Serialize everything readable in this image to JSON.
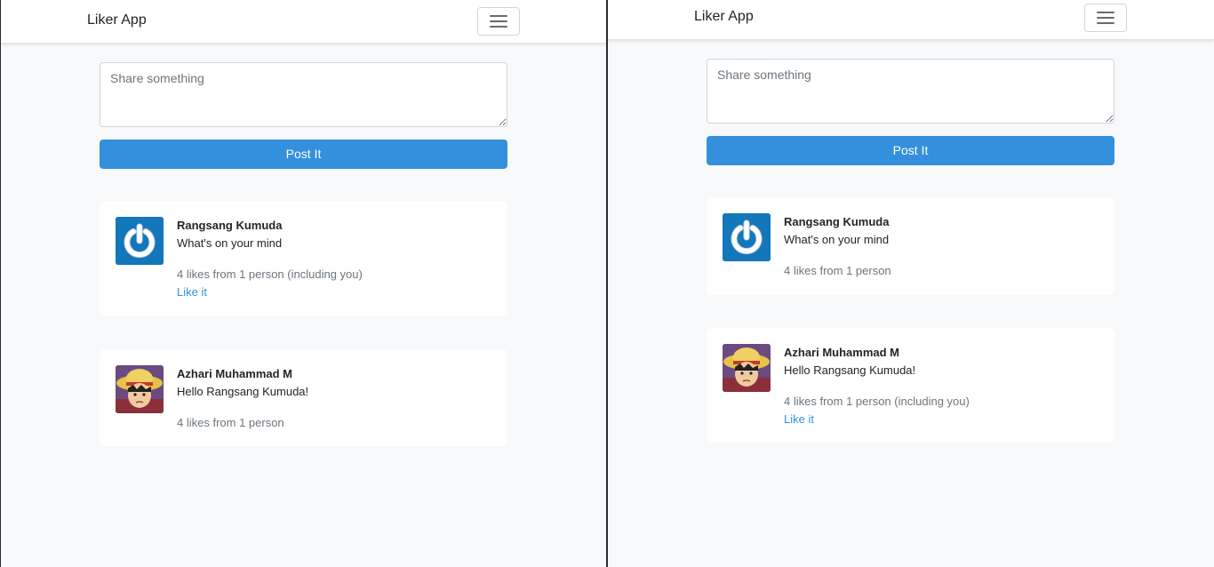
{
  "colors": {
    "primary": "#3490dc",
    "background": "#f8f9fa",
    "card": "#ffffff",
    "muted": "#6c757d"
  },
  "panes": [
    {
      "navbar": {
        "brand": "Liker App",
        "toggler_icon": "hamburger-icon"
      },
      "composer": {
        "placeholder": "Share something",
        "button": "Post It"
      },
      "posts": [
        {
          "avatar": "power-icon-avatar",
          "author": "Rangsang Kumuda",
          "message": "What's on your mind",
          "likes": "4 likes from 1 person (including you)",
          "like_link": "Like it"
        },
        {
          "avatar": "anime-character-avatar",
          "author": "Azhari Muhammad M",
          "message": "Hello Rangsang Kumuda!",
          "likes": "4 likes from 1 person"
        }
      ]
    },
    {
      "navbar": {
        "brand": "Liker App",
        "toggler_icon": "hamburger-icon"
      },
      "composer": {
        "placeholder": "Share something",
        "button": "Post It"
      },
      "posts": [
        {
          "avatar": "power-icon-avatar",
          "author": "Rangsang Kumuda",
          "message": "What's on your mind",
          "likes": "4 likes from 1 person"
        },
        {
          "avatar": "anime-character-avatar",
          "author": "Azhari Muhammad M",
          "message": "Hello Rangsang Kumuda!",
          "likes": "4 likes from 1 person (including you)",
          "like_link": "Like it"
        }
      ]
    }
  ]
}
